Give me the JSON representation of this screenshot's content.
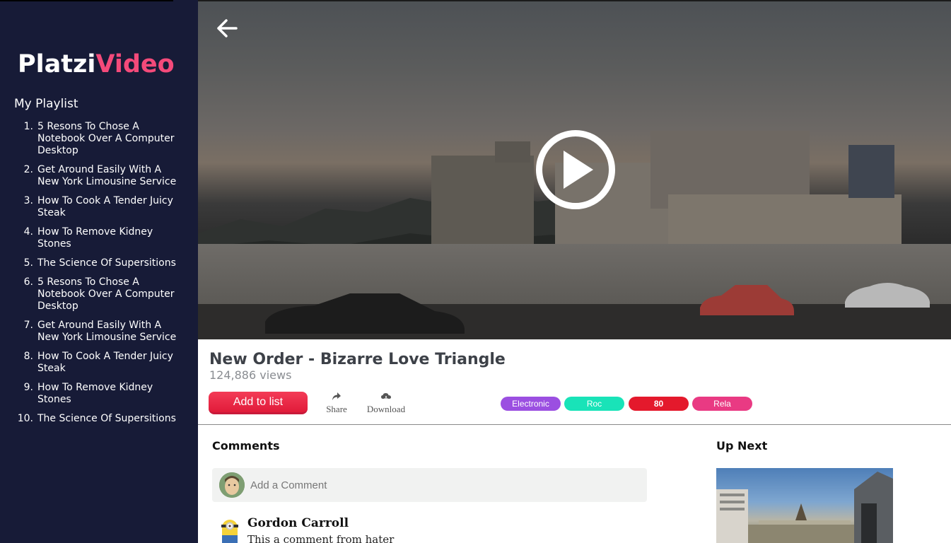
{
  "app": {
    "logo_part1": "Platzi",
    "logo_part2": "Video",
    "accent": "#f44a7a",
    "sidebar_bg": "#171b37"
  },
  "sidebar": {
    "title": "My Playlist",
    "items": [
      {
        "num": "1.",
        "label": "5 Resons To Chose A Notebook Over A Computer Desktop"
      },
      {
        "num": "2.",
        "label": "Get Around Easily With A New York Limousine Service"
      },
      {
        "num": "3.",
        "label": "How To Cook A Tender Juicy Steak"
      },
      {
        "num": "4.",
        "label": "How To Remove Kidney Stones"
      },
      {
        "num": "5.",
        "label": "The Science Of Supersitions"
      },
      {
        "num": "6.",
        "label": "5 Resons To Chose A Notebook Over A Computer Desktop"
      },
      {
        "num": "7.",
        "label": "Get Around Easily With A New York Limousine Service"
      },
      {
        "num": "8.",
        "label": "How To Cook A Tender Juicy Steak"
      },
      {
        "num": "9.",
        "label": "How To Remove Kidney Stones"
      },
      {
        "num": "10.",
        "label": "The Science Of Supersitions"
      }
    ]
  },
  "video": {
    "title": "New Order - Bizarre Love Triangle",
    "views": "124,886 views",
    "back_icon": "arrow-left-icon",
    "play_icon": "play-icon"
  },
  "actions": {
    "add_to_list": "Add to list",
    "share": "Share",
    "download": "Download"
  },
  "tags": [
    {
      "label": "Electronic",
      "color": "#9b4fe1"
    },
    {
      "label": "Roc",
      "color": "#19e3b8"
    },
    {
      "label": "80",
      "color": "#e4192c"
    },
    {
      "label": "Rela",
      "color": "#e93a83"
    }
  ],
  "comments": {
    "title": "Comments",
    "placeholder": "Add a Comment",
    "items": [
      {
        "author": "Gordon Carroll",
        "text": "This a comment from hater"
      }
    ]
  },
  "up_next": {
    "title": "Up Next"
  }
}
